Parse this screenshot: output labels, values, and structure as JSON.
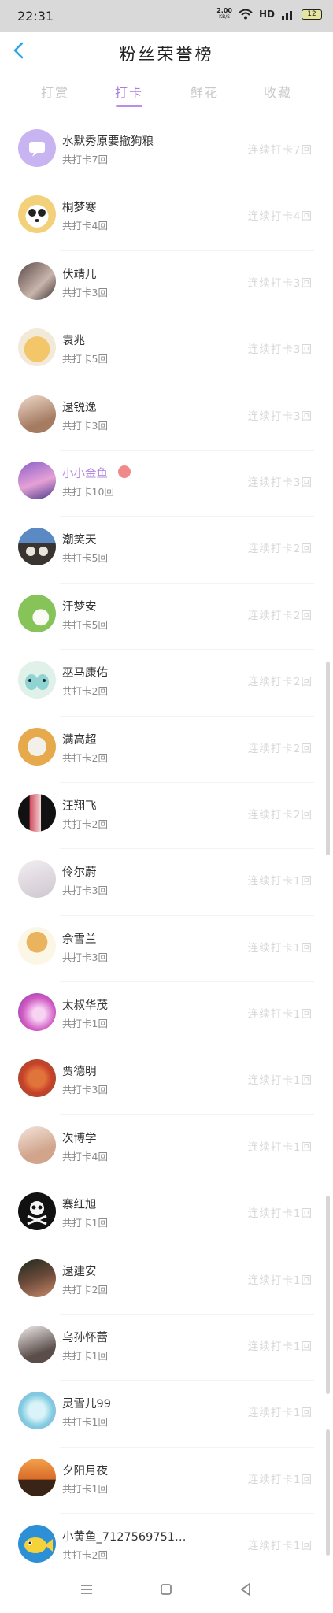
{
  "status": {
    "time": "22:31",
    "speed": "2.00",
    "speed_unit": "KB/S",
    "network": "HD",
    "signal": "4G",
    "battery": "12"
  },
  "header": {
    "title": "粉丝荣誉榜",
    "back_icon": "chevron-left-icon",
    "accent": "#2ba4e8"
  },
  "tabs": [
    {
      "label": "打赏",
      "active": false
    },
    {
      "label": "打卡",
      "active": true
    },
    {
      "label": "鲜花",
      "active": false
    },
    {
      "label": "收藏",
      "active": false
    }
  ],
  "colors": {
    "tab_active": "#a97fdc",
    "highlight_name": "#b48be0"
  },
  "rows": [
    {
      "name": "水默秀原要撤狗粮",
      "count": "共打卡7回",
      "streak": "连续打卡7回",
      "highlight": false,
      "badge": false
    },
    {
      "name": "桐梦寒",
      "count": "共打卡4回",
      "streak": "连续打卡4回",
      "highlight": false,
      "badge": false
    },
    {
      "name": "伏靖儿",
      "count": "共打卡3回",
      "streak": "连续打卡3回",
      "highlight": false,
      "badge": false
    },
    {
      "name": "袁兆",
      "count": "共打卡5回",
      "streak": "连续打卡3回",
      "highlight": false,
      "badge": false
    },
    {
      "name": "逯锐逸",
      "count": "共打卡3回",
      "streak": "连续打卡3回",
      "highlight": false,
      "badge": false
    },
    {
      "name": "小小金鱼",
      "count": "共打卡10回",
      "streak": "连续打卡3回",
      "highlight": true,
      "badge": true
    },
    {
      "name": "潮笑天",
      "count": "共打卡5回",
      "streak": "连续打卡2回",
      "highlight": false,
      "badge": false
    },
    {
      "name": "汗梦安",
      "count": "共打卡5回",
      "streak": "连续打卡2回",
      "highlight": false,
      "badge": false
    },
    {
      "name": "巫马康佑",
      "count": "共打卡2回",
      "streak": "连续打卡2回",
      "highlight": false,
      "badge": false
    },
    {
      "name": "满高超",
      "count": "共打卡2回",
      "streak": "连续打卡2回",
      "highlight": false,
      "badge": false
    },
    {
      "name": "汪翔飞",
      "count": "共打卡2回",
      "streak": "连续打卡2回",
      "highlight": false,
      "badge": false
    },
    {
      "name": "伶尔蔚",
      "count": "共打卡3回",
      "streak": "连续打卡1回",
      "highlight": false,
      "badge": false
    },
    {
      "name": "佘雪兰",
      "count": "共打卡3回",
      "streak": "连续打卡1回",
      "highlight": false,
      "badge": false
    },
    {
      "name": "太叔华茂",
      "count": "共打卡1回",
      "streak": "连续打卡1回",
      "highlight": false,
      "badge": false
    },
    {
      "name": "贾德明",
      "count": "共打卡3回",
      "streak": "连续打卡1回",
      "highlight": false,
      "badge": false
    },
    {
      "name": "次博学",
      "count": "共打卡4回",
      "streak": "连续打卡1回",
      "highlight": false,
      "badge": false
    },
    {
      "name": "寨红旭",
      "count": "共打卡1回",
      "streak": "连续打卡1回",
      "highlight": false,
      "badge": false
    },
    {
      "name": "逯建安",
      "count": "共打卡2回",
      "streak": "连续打卡1回",
      "highlight": false,
      "badge": false
    },
    {
      "name": "乌孙怀蕾",
      "count": "共打卡1回",
      "streak": "连续打卡1回",
      "highlight": false,
      "badge": false
    },
    {
      "name": "灵雪儿99",
      "count": "共打卡1回",
      "streak": "连续打卡1回",
      "highlight": false,
      "badge": false
    },
    {
      "name": "夕阳月夜",
      "count": "共打卡1回",
      "streak": "连续打卡1回",
      "highlight": false,
      "badge": false
    },
    {
      "name": "小黄鱼_7127569751…",
      "count": "共打卡2回",
      "streak": "连续打卡1回",
      "highlight": false,
      "badge": false
    }
  ],
  "navbar": {
    "menu_icon": "menu-icon",
    "home_icon": "home-square-icon",
    "back_icon": "triangle-back-icon"
  }
}
